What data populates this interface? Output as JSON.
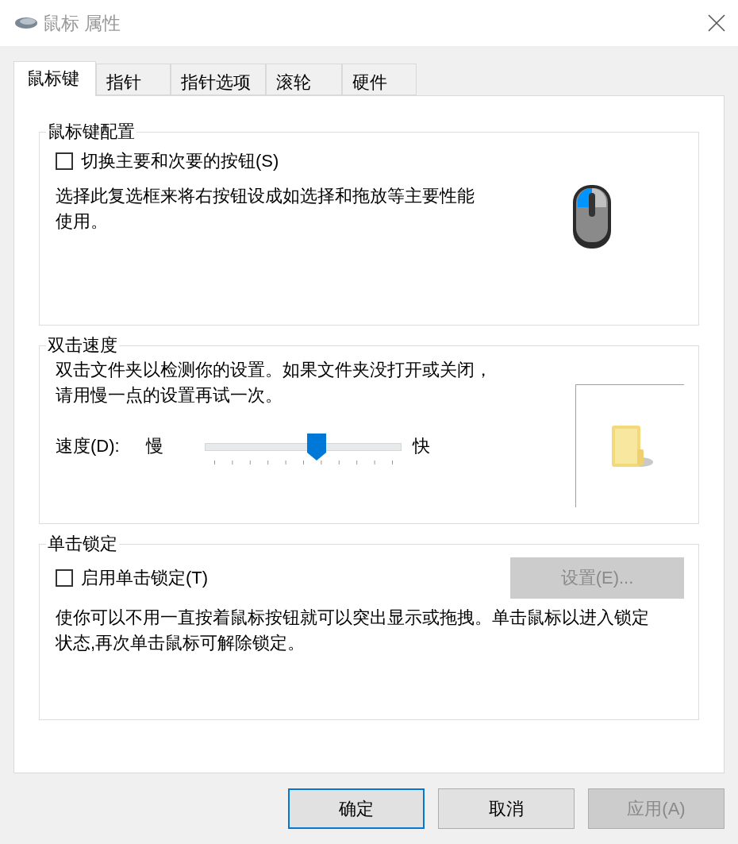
{
  "window": {
    "title": "鼠标 属性"
  },
  "tabs": [
    {
      "label": "鼠标键",
      "selected": true
    },
    {
      "label": "指针",
      "selected": false
    },
    {
      "label": "指针选项",
      "selected": false
    },
    {
      "label": "滚轮",
      "selected": false
    },
    {
      "label": "硬件",
      "selected": false
    }
  ],
  "button_config": {
    "title": "鼠标键配置",
    "checkbox": {
      "label": "切换主要和次要的按钮(S)",
      "checked": false
    },
    "description": "选择此复选框来将右按钮设成如选择和拖放等主要性能使用。"
  },
  "double_click": {
    "title": "双击速度",
    "description": "双击文件夹以检测你的设置。如果文件夹没打开或关闭，请用慢一点的设置再试一次。",
    "speed": {
      "label": "速度(D):",
      "slow": "慢",
      "fast": "快",
      "level": 0.6
    }
  },
  "click_lock": {
    "title": "单击锁定",
    "checkbox": {
      "label": "启用单击锁定(T)",
      "checked": false
    },
    "settings_button": {
      "label": "设置(E)...",
      "disabled": true
    },
    "description": "使你可以不用一直按着鼠标按钮就可以突出显示或拖拽。单击鼠标以进入锁定状态,再次单击鼠标可解除锁定。"
  },
  "buttons": [
    {
      "label": "确定",
      "default": true,
      "disabled": false
    },
    {
      "label": "取消",
      "default": false,
      "disabled": false
    },
    {
      "label": "应用(A)",
      "default": false,
      "disabled": true
    }
  ]
}
